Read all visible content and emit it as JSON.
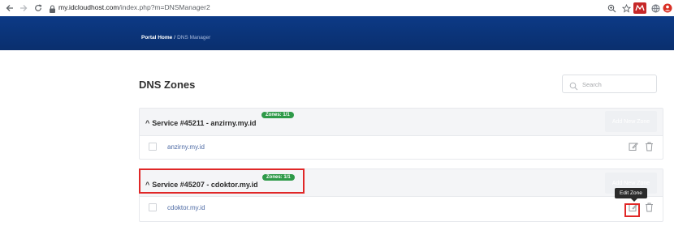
{
  "browser": {
    "url_host": "my.idcloudhost.com",
    "url_path": "/index.php?m=DNSManager2",
    "extensions": [
      "zoom-icon",
      "star-icon",
      "mcafee-icon",
      "globe-icon",
      "account-icon"
    ]
  },
  "breadcrumb": {
    "home": "Portal Home",
    "separator": "/",
    "current": "DNS Manager"
  },
  "page": {
    "title": "DNS Zones",
    "search_placeholder": "Search"
  },
  "services": [
    {
      "title": "Service #45211 - anzirny.my.id",
      "zones_badge": "Zones: 1/1",
      "add_button": "Add New Zone",
      "domains": [
        "anzirny.my.id"
      ]
    },
    {
      "title": "Service #45207 - cdoktor.my.id",
      "zones_badge": "Zones: 1/1",
      "add_button": "Add New Zone",
      "domains": [
        "cdoktor.my.id"
      ]
    }
  ],
  "tooltip": "Edit Zone",
  "colors": {
    "banner": "#0c3a86",
    "badge": "#2e9a48",
    "highlight": "#e02727",
    "link": "#4d6aa4"
  }
}
